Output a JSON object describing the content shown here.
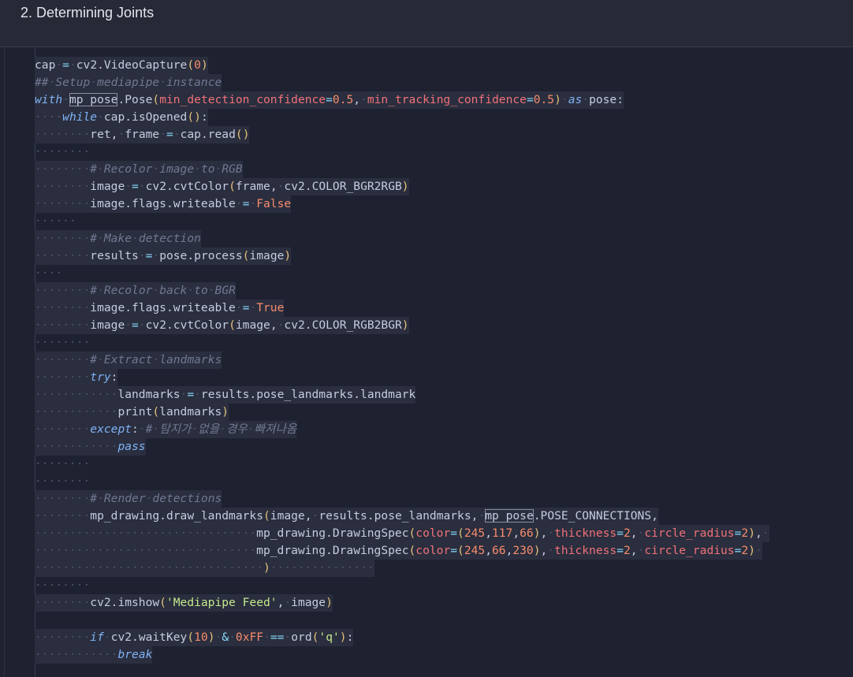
{
  "header": {
    "title": "2. Determining Joints"
  },
  "colors": {
    "background": "#1e2230",
    "header_bg": "#262936",
    "keyword": "#7fb3f5",
    "comment": "#707892",
    "string": "#c3e88d",
    "number": "#f78c6c",
    "param": "#f07178",
    "paren": "#e5c07b"
  },
  "code": {
    "lines": [
      "cap = cv2.VideoCapture(0)",
      "## Setup mediapipe instance",
      "with mp_pose.Pose(min_detection_confidence=0.5, min_tracking_confidence=0.5) as pose:",
      "    while cap.isOpened():",
      "        ret, frame = cap.read()",
      "        ",
      "        # Recolor image to RGB",
      "        image = cv2.cvtColor(frame, cv2.COLOR_BGR2RGB)",
      "        image.flags.writeable = False",
      "      ",
      "        # Make detection",
      "        results = pose.process(image)",
      "    ",
      "        # Recolor back to BGR",
      "        image.flags.writeable = True",
      "        image = cv2.cvtColor(image, cv2.COLOR_RGB2BGR)",
      "        ",
      "        # Extract landmarks",
      "        try:",
      "            landmarks = results.pose_landmarks.landmark",
      "            print(landmarks)",
      "        except: # 탐지가 없을 경우 빠져나옴",
      "            pass",
      "        ",
      "        ",
      "        # Render detections",
      "        mp_drawing.draw_landmarks(image, results.pose_landmarks, mp_pose.POSE_CONNECTIONS,",
      "                                mp_drawing.DrawingSpec(color=(245,117,66), thickness=2, circle_radius=2), ",
      "                                mp_drawing.DrawingSpec(color=(245,66,230), thickness=2, circle_radius=2) ",
      "                                 )               ",
      "        ",
      "        cv2.imshow('Mediapipe Feed', image)",
      "",
      "        if cv2.waitKey(10) & 0xFF == ord('q'):",
      "            break"
    ]
  }
}
